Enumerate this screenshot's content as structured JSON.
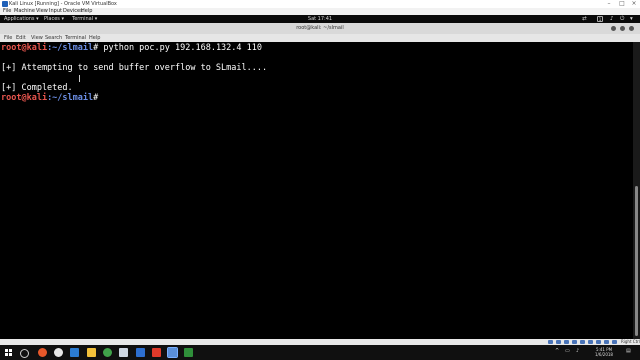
{
  "vbox": {
    "title": "Kali Linux [Running] - Oracle VM VirtualBox",
    "menu": [
      "File",
      "Machine",
      "View",
      "Input",
      "Devices",
      "Help"
    ],
    "controls": [
      "–",
      "□",
      "×"
    ],
    "host_key": "Right Ctrl"
  },
  "gnome": {
    "applications": "Applications ▾",
    "places": "Places ▾",
    "terminal": "Terminal ▾",
    "clock": "Sat 17:41",
    "workspace": "1"
  },
  "terminal": {
    "title": "root@kali: ~/slmail",
    "menu": [
      "File",
      "Edit",
      "View",
      "Search",
      "Terminal",
      "Help"
    ],
    "lines": [
      {
        "user": "root@kali",
        "path": ":~/slmail",
        "cmd": "# python poc.py 192.168.132.4 110"
      },
      {
        "text": "[+] Attempting to send buffer overflow to SLmail...."
      },
      {
        "text": "[+] Completed."
      },
      {
        "user": "root@kali",
        "path": ":~/slmail",
        "cmd": "#"
      }
    ]
  },
  "taskbar": {
    "time": "5:41 PM",
    "date": "1/6/2018"
  },
  "colors": {
    "prompt_user": "#e8554e",
    "prompt_path": "#6b8de3",
    "terminal_bg": "#000000",
    "gnome_bar": "#0a0a0a"
  }
}
